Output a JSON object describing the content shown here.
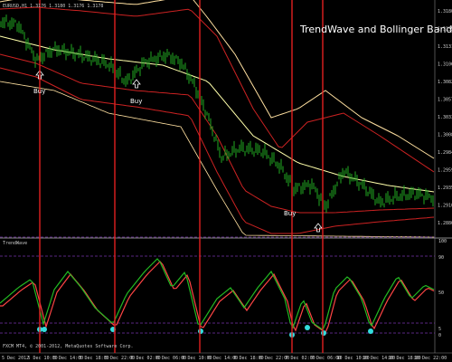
{
  "chart_header": {
    "symbol_info": "EURUSD,H1  1.3176 1.3180 1.3176 1.3178",
    "overlay_title": "TrendWave and Bollinger Bands",
    "indicator_label": "TrendWave",
    "copyright": "FXCM MT4, © 2001-2012, MetaQuotes Software Corp."
  },
  "buy_labels": [
    "Buy",
    "Buy",
    "Buy"
  ],
  "colors": {
    "candle": "#22aa22",
    "bb_outer": "#ffe0a0",
    "bb_mid": "#cc2222",
    "center": "#ffffaa",
    "signal_line": "#e02020",
    "osc_green": "#22bb22",
    "osc_red": "#ff4444",
    "dots": "#33dddd",
    "purple": "#7733aa"
  },
  "chart_data": {
    "type": "line",
    "title": "TrendWave and Bollinger Bands",
    "price_axis_ticks": [
      "1.31800",
      "1.31555",
      "1.31310",
      "1.31065",
      "1.30820",
      "1.30575",
      "1.30330",
      "1.30085",
      "1.29840",
      "1.29595",
      "1.29350",
      "1.29105",
      "1.28860"
    ],
    "indicator_axis_ticks": [
      "100",
      "90",
      "50",
      "5",
      "0"
    ],
    "time_ticks": [
      "5 Dec 2012",
      "5 Dec 10:00",
      "5 Dec 14:00",
      "5 Dec 18:00",
      "5 Dec 22:00",
      "6 Dec 02:00",
      "6 Dec 06:00",
      "6 Dec 10:00",
      "6 Dec 14:00",
      "6 Dec 18:00",
      "6 Dec 22:00",
      "7 Dec 02:00",
      "7 Dec 06:00",
      "10 Dec 10:00",
      "10 Dec 14:00",
      "10 Dec 18:00",
      "10 Dec 22:00"
    ],
    "signal_markers": [
      "Buy",
      "Buy",
      "Buy"
    ]
  }
}
